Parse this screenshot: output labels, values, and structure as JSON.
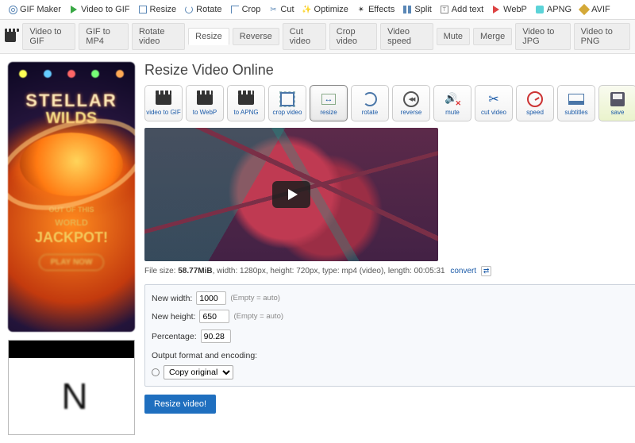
{
  "topnav": [
    {
      "id": "gif-maker",
      "label": "GIF Maker",
      "icon": "gear"
    },
    {
      "id": "video-to-gif",
      "label": "Video to GIF",
      "icon": "play-green"
    },
    {
      "id": "resize",
      "label": "Resize",
      "icon": "resize"
    },
    {
      "id": "rotate",
      "label": "Rotate",
      "icon": "rotate"
    },
    {
      "id": "crop",
      "label": "Crop",
      "icon": "crop"
    },
    {
      "id": "cut",
      "label": "Cut",
      "icon": "cut"
    },
    {
      "id": "optimize",
      "label": "Optimize",
      "icon": "wand"
    },
    {
      "id": "effects",
      "label": "Effects",
      "icon": "wand2"
    },
    {
      "id": "split",
      "label": "Split",
      "icon": "split"
    },
    {
      "id": "add-text",
      "label": "Add text",
      "icon": "text"
    },
    {
      "id": "webp",
      "label": "WebP",
      "icon": "play-red"
    },
    {
      "id": "apng",
      "label": "APNG",
      "icon": "apng"
    },
    {
      "id": "avif",
      "label": "AVIF",
      "icon": "avif"
    }
  ],
  "subnav": [
    {
      "id": "video-to-gif",
      "label": "Video to GIF"
    },
    {
      "id": "gif-to-mp4",
      "label": "GIF to MP4"
    },
    {
      "id": "rotate-video",
      "label": "Rotate video"
    },
    {
      "id": "resize",
      "label": "Resize",
      "active": true
    },
    {
      "id": "reverse",
      "label": "Reverse"
    },
    {
      "id": "cut-video",
      "label": "Cut video"
    },
    {
      "id": "crop-video",
      "label": "Crop video"
    },
    {
      "id": "video-speed",
      "label": "Video speed"
    },
    {
      "id": "mute",
      "label": "Mute"
    },
    {
      "id": "merge",
      "label": "Merge"
    },
    {
      "id": "video-to-jpg",
      "label": "Video to JPG"
    },
    {
      "id": "video-to-png",
      "label": "Video to PNG"
    }
  ],
  "page_title": "Resize Video Online",
  "toolbar": [
    {
      "id": "video-to-gif",
      "label": "video to GIF",
      "icon": "clap"
    },
    {
      "id": "to-webp",
      "label": "to WebP",
      "icon": "clap"
    },
    {
      "id": "to-apng",
      "label": "to APNG",
      "icon": "clap"
    },
    {
      "id": "crop-video",
      "label": "crop video",
      "icon": "crop"
    },
    {
      "id": "resize",
      "label": "resize",
      "icon": "resize",
      "active": true
    },
    {
      "id": "rotate",
      "label": "rotate",
      "icon": "rotate"
    },
    {
      "id": "reverse",
      "label": "reverse",
      "icon": "reverse"
    },
    {
      "id": "mute",
      "label": "mute",
      "icon": "mute"
    },
    {
      "id": "cut-video",
      "label": "cut video",
      "icon": "cut"
    },
    {
      "id": "speed",
      "label": "speed",
      "icon": "speed"
    },
    {
      "id": "subtitles",
      "label": "subtitles",
      "icon": "subtitles"
    },
    {
      "id": "save",
      "label": "save",
      "icon": "save",
      "save": true
    }
  ],
  "file_info": {
    "prefix": "File size: ",
    "size": "58.77MiB",
    "rest": ", width: 1280px, height: 720px, type: mp4 (video), length: 00:05:31",
    "convert": "convert",
    "arrows": "⇄"
  },
  "form": {
    "width_label": "New width:",
    "width_value": "1000",
    "height_label": "New height:",
    "height_value": "650",
    "empty_hint": "(Empty = auto)",
    "percentage_label": "Percentage:",
    "percentage_value": "90.28",
    "format_label": "Output format and encoding:",
    "format_value": "Copy original",
    "button": "Resize video!"
  },
  "ad1": {
    "stellar": "STELLAR",
    "wilds": "WILDS",
    "sub1": "OUT OF THIS",
    "sub2": "WORLD",
    "jack": "JACKPOT!",
    "play": "PLAY NOW"
  },
  "ad2": {
    "glyph": "N"
  }
}
